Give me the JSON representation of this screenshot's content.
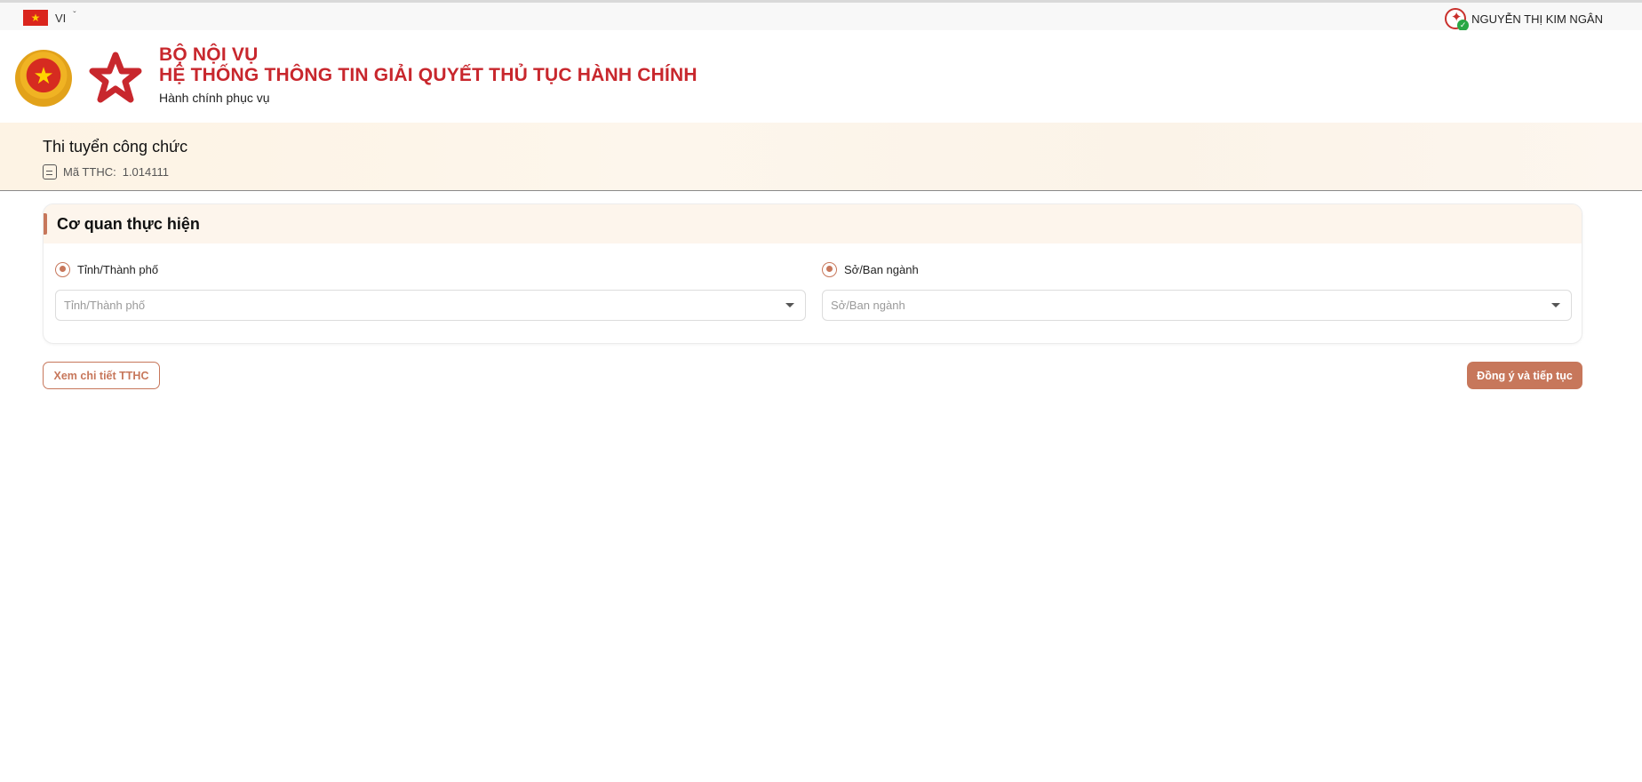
{
  "topbar": {
    "language_code": "VI",
    "user_name": "NGUYỄN THỊ KIM NGÂN"
  },
  "header": {
    "org_name": "BỘ NỘI VỤ",
    "system_name": "HỆ THỐNG THÔNG TIN GIẢI QUYẾT THỦ TỤC HÀNH CHÍNH",
    "slogan": "Hành chính phục vụ"
  },
  "procedure": {
    "title": "Thi tuyển công chức",
    "code_label": "Mã TTHC:",
    "code_value": "1.014111"
  },
  "agency": {
    "section_title": "Cơ quan thực hiện",
    "options": [
      {
        "label": "Tỉnh/Thành phố",
        "selected": true,
        "select_placeholder": "Tỉnh/Thành phố"
      },
      {
        "label": "Sở/Ban ngành",
        "selected": true,
        "select_placeholder": "Sở/Ban ngành"
      }
    ]
  },
  "actions": {
    "view_detail_label": "Xem chi tiết TTHC",
    "agree_continue_label": "Đồng ý và tiếp tục"
  },
  "icons": {
    "flag": "vietnam-flag-icon",
    "dropdown": "caret-down-icon",
    "document": "document-icon"
  },
  "colors": {
    "brand_red": "#c8272d",
    "accent": "#c7775b",
    "band_bg": "#fdf3e4"
  }
}
